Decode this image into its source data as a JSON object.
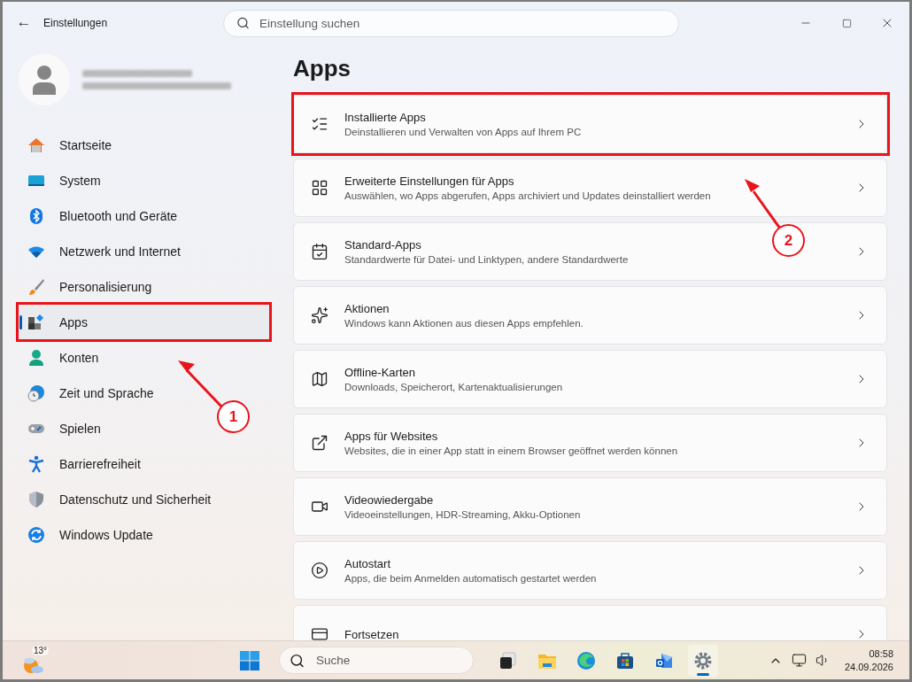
{
  "window": {
    "title": "Einstellungen",
    "back": "←"
  },
  "search": {
    "placeholder": "Einstellung suchen"
  },
  "sidebar": {
    "items": [
      {
        "label": "Startseite",
        "selected": false,
        "highlighted": false
      },
      {
        "label": "System",
        "selected": false,
        "highlighted": false
      },
      {
        "label": "Bluetooth und Geräte",
        "selected": false,
        "highlighted": false
      },
      {
        "label": "Netzwerk und Internet",
        "selected": false,
        "highlighted": false
      },
      {
        "label": "Personalisierung",
        "selected": false,
        "highlighted": false
      },
      {
        "label": "Apps",
        "selected": true,
        "highlighted": true
      },
      {
        "label": "Konten",
        "selected": false,
        "highlighted": false
      },
      {
        "label": "Zeit und Sprache",
        "selected": false,
        "highlighted": false
      },
      {
        "label": "Spielen",
        "selected": false,
        "highlighted": false
      },
      {
        "label": "Barrierefreiheit",
        "selected": false,
        "highlighted": false
      },
      {
        "label": "Datenschutz und Sicherheit",
        "selected": false,
        "highlighted": false
      },
      {
        "label": "Windows Update",
        "selected": false,
        "highlighted": false
      }
    ]
  },
  "page": {
    "title": "Apps"
  },
  "cards": [
    {
      "title": "Installierte Apps",
      "description": "Deinstallieren und Verwalten von Apps auf Ihrem PC",
      "highlighted": true
    },
    {
      "title": "Erweiterte Einstellungen für Apps",
      "description": "Auswählen, wo Apps abgerufen, Apps archiviert und Updates deinstalliert werden",
      "highlighted": false
    },
    {
      "title": "Standard-Apps",
      "description": "Standardwerte für Datei- und Linktypen, andere Standardwerte",
      "highlighted": false
    },
    {
      "title": "Aktionen",
      "description": "Windows kann Aktionen aus diesen Apps empfehlen.",
      "highlighted": false
    },
    {
      "title": "Offline-Karten",
      "description": "Downloads, Speicherort, Kartenaktualisierungen",
      "highlighted": false
    },
    {
      "title": "Apps für Websites",
      "description": "Websites, die in einer App statt in einem Browser geöffnet werden können",
      "highlighted": false
    },
    {
      "title": "Videowiedergabe",
      "description": "Videoeinstellungen, HDR-Streaming, Akku-Optionen",
      "highlighted": false
    },
    {
      "title": "Autostart",
      "description": "Apps, die beim Anmelden automatisch gestartet werden",
      "highlighted": false
    },
    {
      "title": "Fortsetzen",
      "highlighted": false
    }
  ],
  "annotations": [
    {
      "number": "1"
    },
    {
      "number": "2"
    }
  ],
  "taskbar": {
    "weather": "13°",
    "search_placeholder": "Suche",
    "apps": [
      {
        "selected": false
      },
      {
        "selected": false
      },
      {
        "selected": false
      },
      {
        "selected": false
      },
      {
        "selected": false
      },
      {
        "selected": true
      }
    ],
    "time": "08:58",
    "date": "24.09.2026"
  }
}
